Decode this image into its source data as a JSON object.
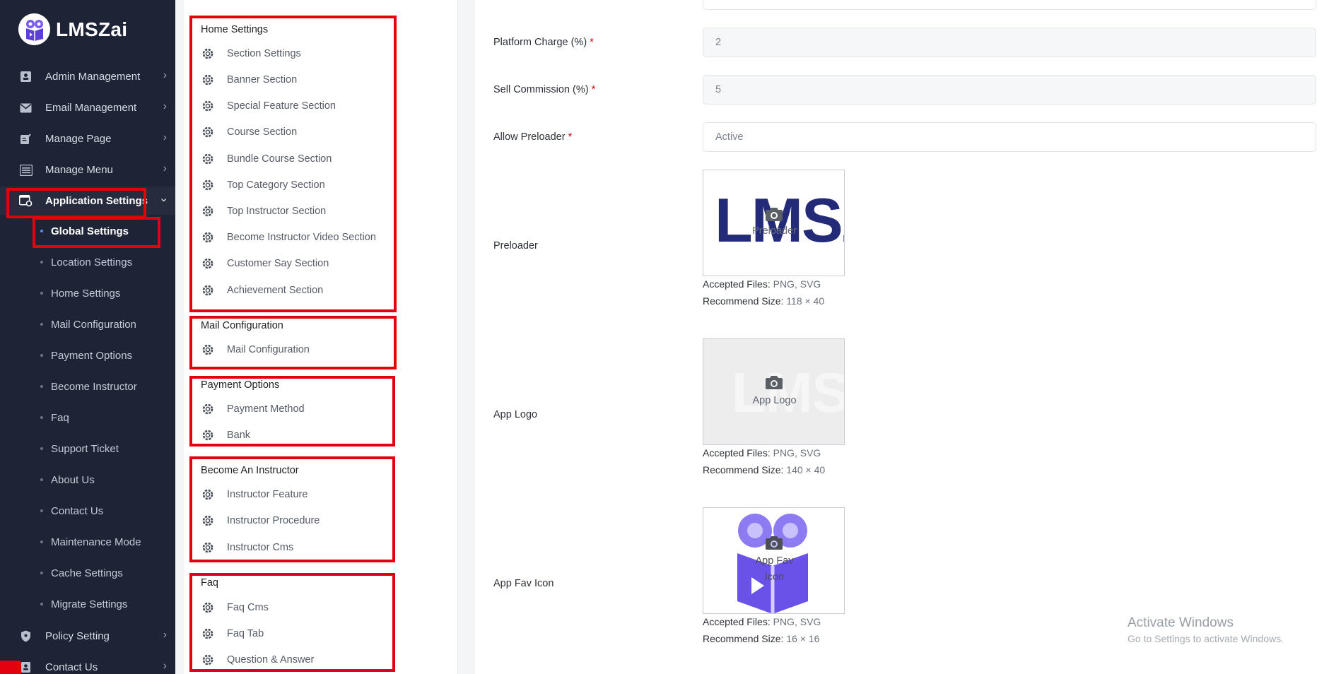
{
  "app": {
    "brand": "LMSZai"
  },
  "sidebar": {
    "top_items": [
      {
        "label": "Admin Management",
        "icon": "admin-icon"
      },
      {
        "label": "Email Management",
        "icon": "email-icon"
      },
      {
        "label": "Manage Page",
        "icon": "page-icon"
      },
      {
        "label": "Manage Menu",
        "icon": "menu-icon"
      },
      {
        "label": "Application Settings",
        "icon": "settings-icon"
      }
    ],
    "sub_items": [
      "Global Settings",
      "Location Settings",
      "Home Settings",
      "Mail Configuration",
      "Payment Options",
      "Become Instructor",
      "Faq",
      "Support Ticket",
      "About Us",
      "Contact Us",
      "Maintenance Mode",
      "Cache Settings",
      "Migrate Settings"
    ],
    "bottom_items": [
      {
        "label": "Policy Setting",
        "icon": "shield-icon"
      },
      {
        "label": "Contact Us",
        "icon": "contact-icon"
      }
    ]
  },
  "settings_menu": {
    "home": {
      "title": "Home Settings",
      "links": [
        "Section Settings",
        "Banner Section",
        "Special Feature Section",
        "Course Section",
        "Bundle Course Section",
        "Top Category Section",
        "Top Instructor Section",
        "Become Instructor Video Section",
        "Customer Say Section",
        "Achievement Section"
      ]
    },
    "mail": {
      "title": "Mail Configuration",
      "links": [
        "Mail Configuration"
      ]
    },
    "payment": {
      "title": "Payment Options",
      "links": [
        "Payment Method",
        "Bank"
      ]
    },
    "instructor": {
      "title": "Become An Instructor",
      "links": [
        "Instructor Feature",
        "Instructor Procedure",
        "Instructor Cms"
      ]
    },
    "faq": {
      "title": "Faq",
      "links": [
        "Faq Cms",
        "Faq Tab",
        "Question & Answer"
      ]
    }
  },
  "form": {
    "platform_charge": {
      "label": "Platform Charge (%)",
      "value": "2"
    },
    "sell_commission": {
      "label": "Sell Commission (%)",
      "value": "5"
    },
    "allow_preloader": {
      "label": "Allow Preloader",
      "value": "Active"
    },
    "required_mark": "*",
    "preloader": {
      "label": "Preloader",
      "placeholder": "Preloader",
      "accepted_label": "Accepted Files:",
      "accepted": "PNG, SVG",
      "size_label": "Recommend Size:",
      "size": "118 × 40",
      "preview_text": "LMSZ"
    },
    "app_logo": {
      "label": "App Logo",
      "placeholder": "App Logo",
      "accepted_label": "Accepted Files:",
      "accepted": "PNG, SVG",
      "size_label": "Recommend Size:",
      "size": "140 × 40",
      "preview_text": "LMS"
    },
    "fav_icon": {
      "label": "App Fav Icon",
      "placeholder_1": "App Fav",
      "placeholder_2": "Icon",
      "accepted_label": "Accepted Files:",
      "accepted": "PNG, SVG",
      "size_label": "Recommend Size:",
      "size": "16 × 16"
    }
  },
  "watermark": {
    "line1": "Activate Windows",
    "line2": "Go to Settings to activate Windows."
  },
  "colors": {
    "sidebar_bg": "#1e2436",
    "highlight": "#e3000f",
    "brand_purple": "#6b4de6"
  }
}
